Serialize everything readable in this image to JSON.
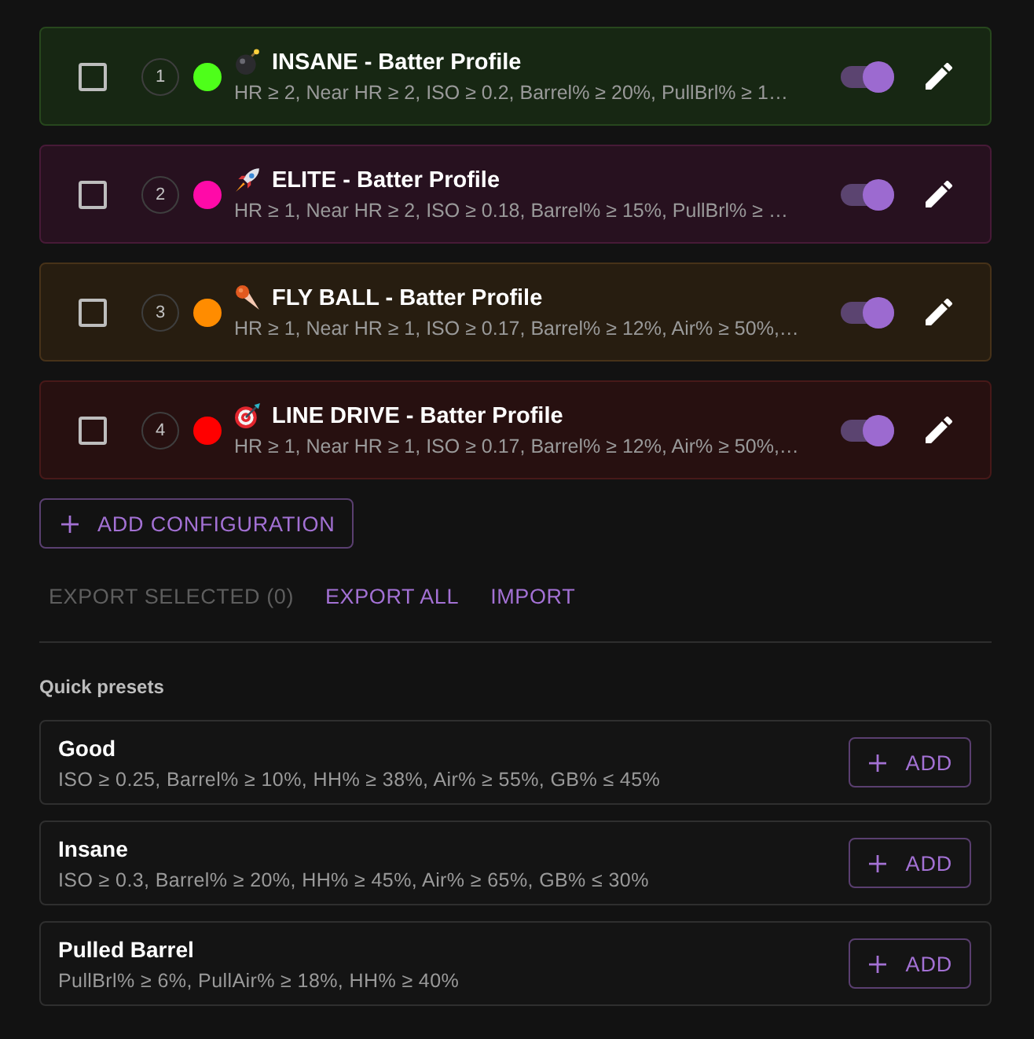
{
  "configurations": [
    {
      "checked": false,
      "number": "1",
      "color": "#4eff1a",
      "title": "INSANE - Batter Profile",
      "criteria": "HR ≥ 2, Near HR ≥ 2, ISO ≥ 0.2, Barrel% ≥ 20%, PullBrl% ≥ 1…",
      "enabled": true
    },
    {
      "checked": false,
      "number": "2",
      "color": "#ff0aa8",
      "title": "ELITE - Batter Profile",
      "criteria": "HR ≥ 1, Near HR ≥ 2, ISO ≥ 0.18, Barrel% ≥ 15%, PullBrl% ≥ …",
      "enabled": true
    },
    {
      "checked": false,
      "number": "3",
      "color": "#ff8c00",
      "title": "FLY BALL - Batter Profile",
      "criteria": "HR ≥ 1, Near HR ≥ 1, ISO ≥ 0.17, Barrel% ≥ 12%, Air% ≥ 50%,…",
      "enabled": true
    },
    {
      "checked": false,
      "number": "4",
      "color": "#ff0000",
      "title": "LINE DRIVE - Batter Profile",
      "criteria": "HR ≥ 1, Near HR ≥ 1, ISO ≥ 0.17, Barrel% ≥ 12%, Air% ≥ 50%,…",
      "enabled": true
    }
  ],
  "add_configuration_button": {
    "label": "ADD CONFIGURATION"
  },
  "actions": [
    {
      "label": "EXPORT SELECTED (0)",
      "disabled": true
    },
    {
      "label": "EXPORT ALL",
      "disabled": false
    },
    {
      "label": "IMPORT",
      "disabled": false
    }
  ],
  "quick_presets": {
    "heading": "Quick presets",
    "items": [
      {
        "name": "Good",
        "criteria": "ISO ≥ 0.25, Barrel% ≥ 10%, HH% ≥ 38%, Air% ≥ 55%, GB% ≤ 45%",
        "button": "ADD"
      },
      {
        "name": "Insane",
        "criteria": "ISO ≥ 0.3, Barrel% ≥ 20%, HH% ≥ 45%, Air% ≥ 65%, GB% ≤ 30%",
        "button": "ADD"
      },
      {
        "name": "Pulled Barrel",
        "criteria": "PullBrl% ≥ 6%, PullAir% ≥ 18%, HH% ≥ 40%",
        "button": "ADD"
      }
    ]
  }
}
